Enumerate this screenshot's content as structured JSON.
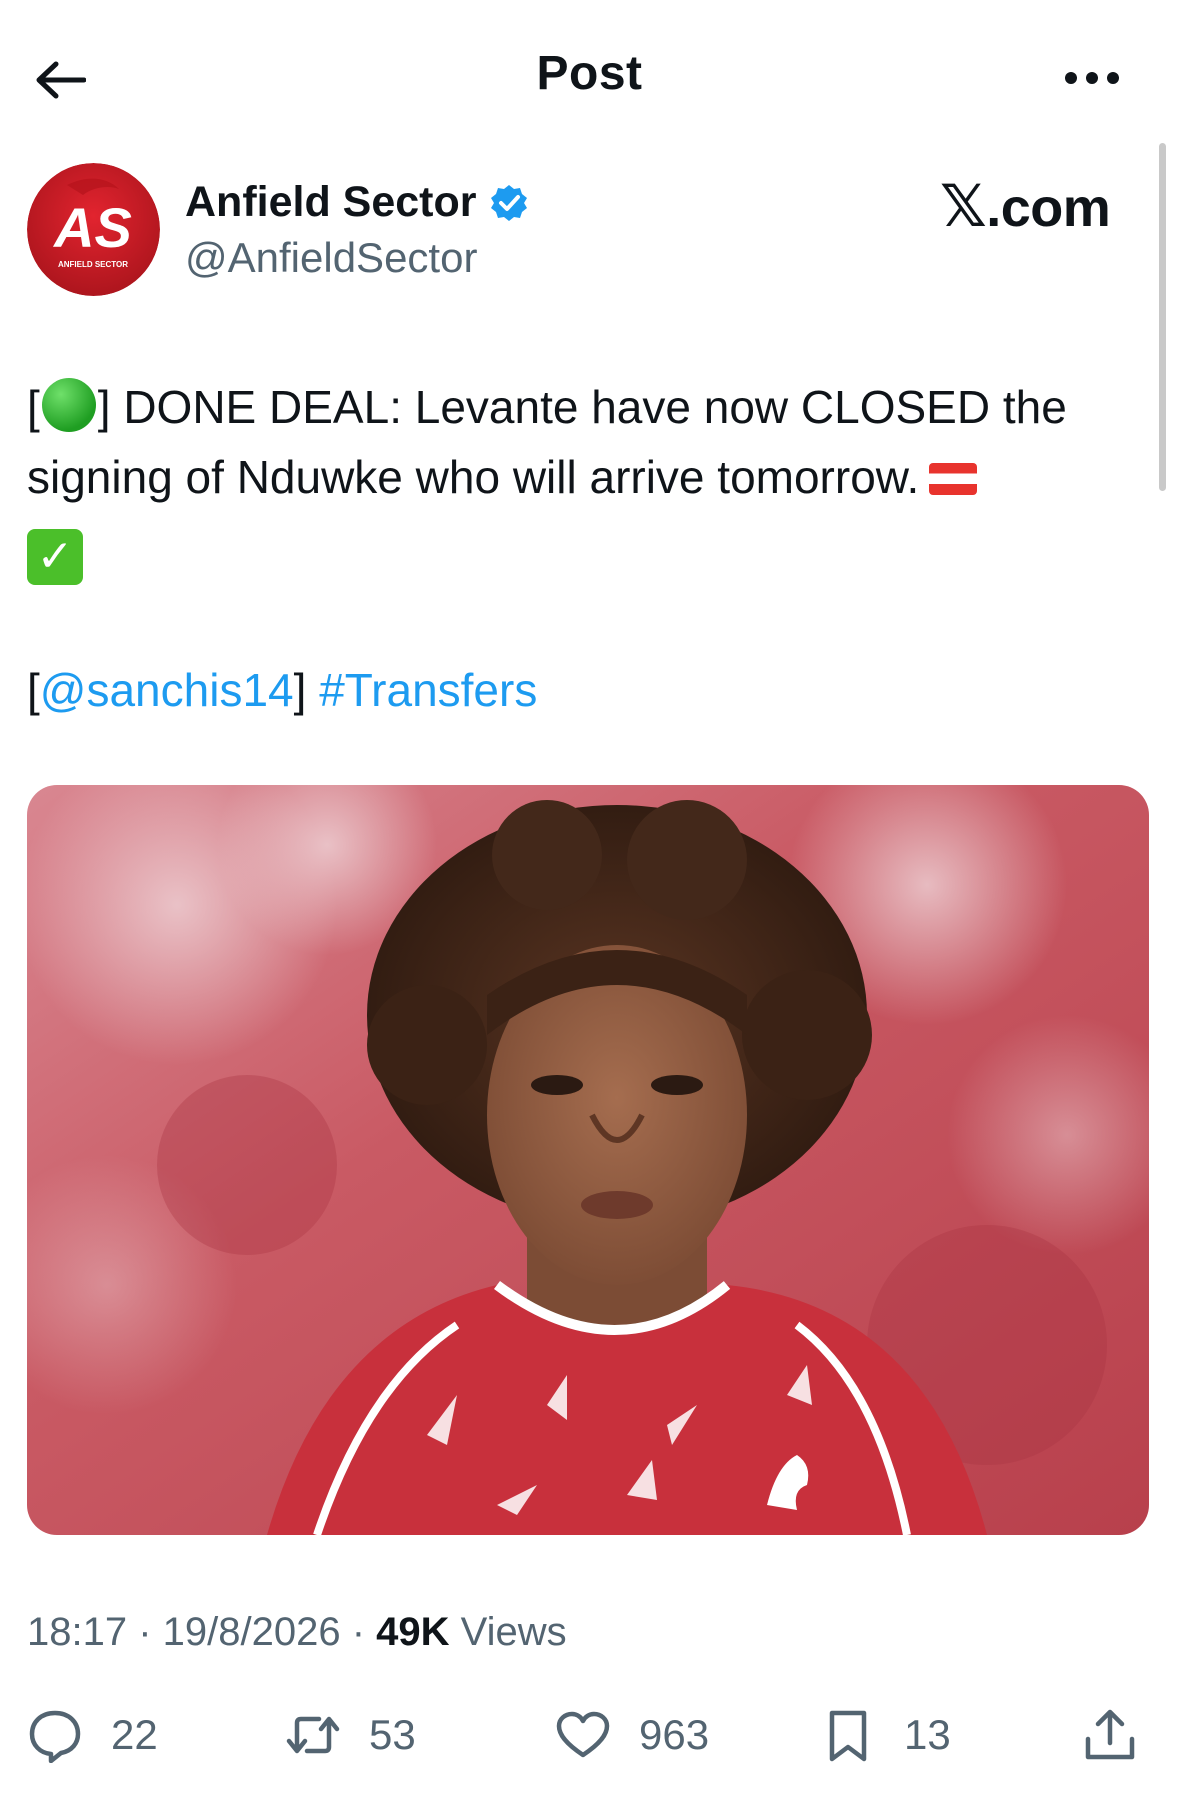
{
  "header": {
    "title": "Post"
  },
  "author": {
    "display_name": "Anfield Sector",
    "handle": "@AnfieldSector",
    "avatar_text": "AS",
    "avatar_subtext": "ANFIELD SECTOR"
  },
  "source_logo": {
    "mark": "𝕏",
    "text": ".com"
  },
  "tweet": {
    "line1_open": "[",
    "line1_text": "] DONE DEAL: Levante have now CLOSED the",
    "line2_text": "signing of Nduwke who will arrive tomorrow.",
    "mention_open": "[",
    "mention": "@sanchis14",
    "mention_close": "]",
    "hashtag": "#Transfers"
  },
  "meta": {
    "time": "18:17",
    "separator": " · ",
    "date": "19/8/2026",
    "views_count": "49K",
    "views_label": " Views"
  },
  "actions": {
    "replies": "22",
    "reposts": "53",
    "likes": "963",
    "bookmarks": "13"
  },
  "colors": {
    "accent": "#1d9bf0",
    "secondary_text": "#536471",
    "primary_text": "#0f1419",
    "avatar_red": "#d01e2a"
  }
}
